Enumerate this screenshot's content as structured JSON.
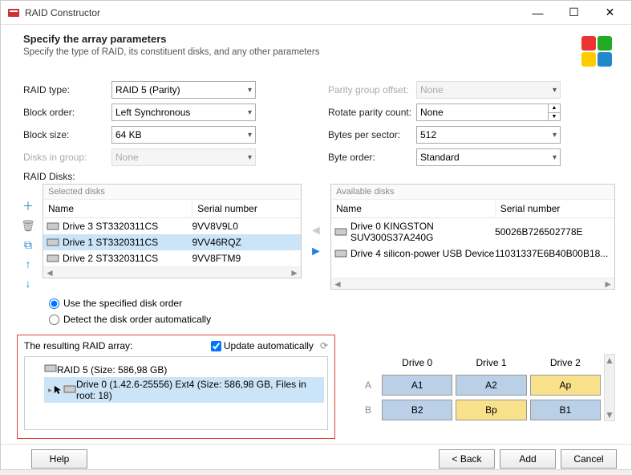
{
  "window": {
    "title": "RAID Constructor"
  },
  "header": {
    "title": "Specify the array parameters",
    "subtitle": "Specify the type of RAID, its constituent disks, and any other parameters"
  },
  "params_left": {
    "raid_type_label": "RAID type:",
    "raid_type_value": "RAID 5 (Parity)",
    "block_order_label": "Block order:",
    "block_order_value": "Left Synchronous",
    "block_size_label": "Block size:",
    "block_size_value": "64 KB",
    "disks_in_group_label": "Disks in group:",
    "disks_in_group_value": "None"
  },
  "params_right": {
    "parity_offset_label": "Parity group offset:",
    "parity_offset_value": "None",
    "rotate_label": "Rotate parity count:",
    "rotate_value": "None",
    "bytes_label": "Bytes per sector:",
    "bytes_value": "512",
    "byte_order_label": "Byte order:",
    "byte_order_value": "Standard"
  },
  "raid_disks_label": "RAID Disks:",
  "selected": {
    "heading": "Selected disks",
    "col_name": "Name",
    "col_serial": "Serial number",
    "rows": [
      {
        "name": "Drive 3 ST3320311CS",
        "serial": "9VV8V9L0"
      },
      {
        "name": "Drive 1 ST3320311CS",
        "serial": "9VV46RQZ"
      },
      {
        "name": "Drive 2 ST3320311CS",
        "serial": "9VV8FTM9"
      }
    ]
  },
  "available": {
    "heading": "Available disks",
    "col_name": "Name",
    "col_serial": "Serial number",
    "rows": [
      {
        "name": "Drive 0 KINGSTON SUV300S37A240G",
        "serial": "50026B726502778E"
      },
      {
        "name": "Drive 4 silicon-power USB Device",
        "serial": "11031337E6B40B00B18..."
      }
    ]
  },
  "radios": {
    "use_order": "Use the specified disk order",
    "detect": "Detect the disk order automatically"
  },
  "result": {
    "label": "The resulting RAID array:",
    "update_label": "Update automatically",
    "root": "RAID 5 (Size: 586,98 GB)",
    "child": "Drive 0 (1.42.6-25556) Ext4 (Size: 586,98 GB, Files in root: 18)"
  },
  "grid": {
    "drive0": "Drive 0",
    "drive1": "Drive 1",
    "drive2": "Drive 2",
    "rowA": "A",
    "rowB": "B",
    "a1": "A1",
    "a2": "A2",
    "ap": "Ap",
    "b2": "B2",
    "bp": "Bp",
    "b1": "B1"
  },
  "footer": {
    "help": "Help",
    "back": "< Back",
    "add": "Add",
    "cancel": "Cancel"
  }
}
